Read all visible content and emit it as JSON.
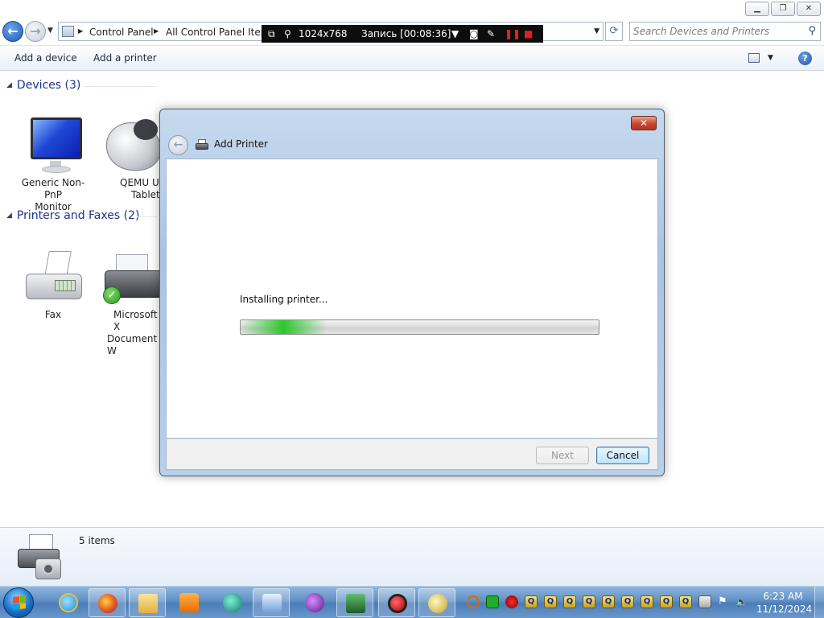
{
  "window": {
    "breadcrumb": [
      "Control Panel",
      "All Control Panel Items"
    ],
    "search_placeholder": "Search Devices and Printers"
  },
  "toolbar": {
    "add_device": "Add a device",
    "add_printer": "Add a printer"
  },
  "groups": {
    "devices": {
      "title": "Devices (3)",
      "items": [
        {
          "label_line1": "Generic Non-PnP",
          "label_line2": "Monitor",
          "icon": "monitor-icon"
        },
        {
          "label_line1": "QEMU US",
          "label_line2": "Tablet",
          "icon": "mouse-icon"
        }
      ]
    },
    "printers": {
      "title": "Printers and Faxes (2)",
      "items": [
        {
          "label_line1": "Fax",
          "label_line2": "",
          "icon": "fax-icon"
        },
        {
          "label_line1": "Microsoft X",
          "label_line2": "Document W",
          "icon": "printer-icon"
        }
      ]
    }
  },
  "details": {
    "count": "5 items"
  },
  "recorder": {
    "resolution": "1024x768",
    "status": "Запись [00:08:36]"
  },
  "dialog": {
    "title": "Add Printer",
    "status": "Installing printer...",
    "progress_glow_fraction": 0.12,
    "next_label": "Next",
    "cancel_label": "Cancel"
  },
  "taskbar": {
    "time": "6:23 AM",
    "date": "11/12/2024"
  },
  "colors": {
    "group_header": "#1e3287",
    "progress_glow": "#26c426",
    "dialog_frame": "#a9c4e3",
    "taskbar": "#5f8fc4"
  }
}
